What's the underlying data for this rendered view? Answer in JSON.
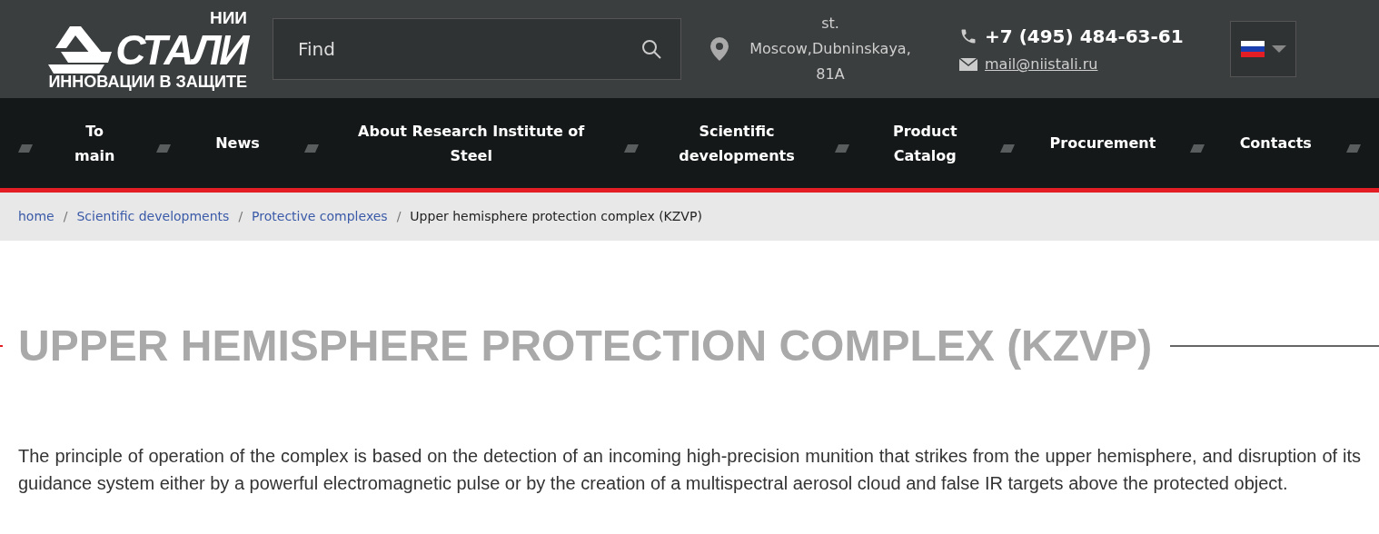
{
  "logo": {
    "top": "НИИ",
    "main": "СТАЛИ",
    "tagline": "ИННОВАЦИИ В ЗАЩИТЕ"
  },
  "search": {
    "placeholder": "Find"
  },
  "address": [
    "st.",
    "Moscow,Dubninskaya,",
    "81A"
  ],
  "phone": "+7 (495) 484-63-61",
  "email": "mail@niistali.ru",
  "nav": [
    {
      "label": "To main"
    },
    {
      "label": "News"
    },
    {
      "label": "About Research Institute of Steel"
    },
    {
      "label": "Scientific developments"
    },
    {
      "label": "Product Catalog"
    },
    {
      "label": "Procurement"
    },
    {
      "label": "Contacts"
    }
  ],
  "breadcrumb_separators": [
    "/",
    "/",
    "/"
  ],
  "breadcrumbs": [
    {
      "label": "home",
      "link": true
    },
    {
      "label": "Scientific developments",
      "link": true
    },
    {
      "label": "Protective complexes",
      "link": true
    },
    {
      "label": "Upper hemisphere protection complex (KZVP)",
      "link": false
    }
  ],
  "title": "UPPER HEMISPHERE PROTECTION COMPLEX (KZVP)",
  "body": "The principle of operation of the complex is based on the detection of an incoming high-precision munition that strikes from the upper hemisphere, and disruption of its guidance system either by a powerful electromagnetic pulse or by the creation of a multispectral aerosol cloud and false IR targets above the protected object."
}
